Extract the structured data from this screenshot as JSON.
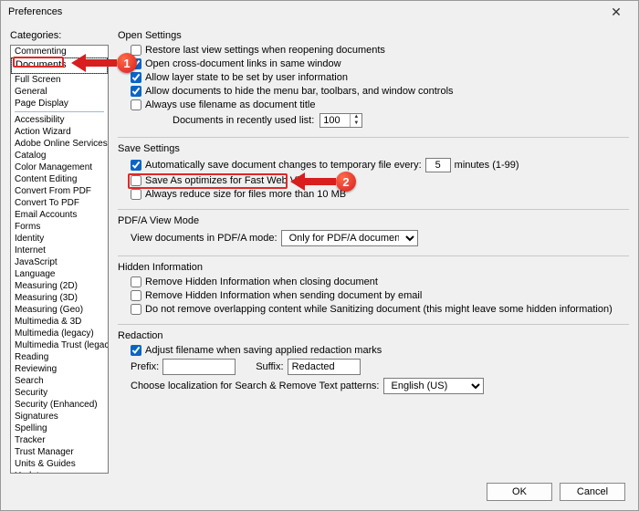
{
  "title": "Preferences",
  "categoriesLabel": "Categories:",
  "categories1": [
    "Commenting",
    "Documents",
    "Full Screen",
    "General",
    "Page Display"
  ],
  "categories2": [
    "Accessibility",
    "Action Wizard",
    "Adobe Online Services",
    "Catalog",
    "Color Management",
    "Content Editing",
    "Convert From PDF",
    "Convert To PDF",
    "Email Accounts",
    "Forms",
    "Identity",
    "Internet",
    "JavaScript",
    "Language",
    "Measuring (2D)",
    "Measuring (3D)",
    "Measuring (Geo)",
    "Multimedia & 3D",
    "Multimedia (legacy)",
    "Multimedia Trust (legacy)",
    "Reading",
    "Reviewing",
    "Search",
    "Security",
    "Security (Enhanced)",
    "Signatures",
    "Spelling",
    "Tracker",
    "Trust Manager",
    "Units & Guides",
    "Updater"
  ],
  "selectedCategoryIndex": 1,
  "open": {
    "title": "Open Settings",
    "restore": "Restore last view settings when reopening documents",
    "crossdoc": "Open cross-document links in same window",
    "layer": "Allow layer state to be set by user information",
    "hidemenu": "Allow documents to hide the menu bar, toolbars, and window controls",
    "filename": "Always use filename as document title",
    "recent_label": "Documents in recently used list:",
    "recent_value": "100"
  },
  "save": {
    "title": "Save Settings",
    "autosave": "Automatically save document changes to temporary file every:",
    "autosave_value": "5",
    "autosave_unit": "minutes (1-99)",
    "fastweb": "Save As optimizes for Fast Web View",
    "reduce": "Always reduce size for files more than 10 MB"
  },
  "pdfa": {
    "title": "PDF/A View Mode",
    "label": "View documents in PDF/A mode:",
    "value": "Only for PDF/A documents"
  },
  "hidden": {
    "title": "Hidden Information",
    "close": "Remove Hidden Information when closing document",
    "email": "Remove Hidden Information when sending document by email",
    "sanitize": "Do not remove overlapping content while Sanitizing document (this might leave some hidden information)"
  },
  "redact": {
    "title": "Redaction",
    "adjust": "Adjust filename when saving applied redaction marks",
    "prefix_lbl": "Prefix:",
    "prefix_val": "",
    "suffix_lbl": "Suffix:",
    "suffix_val": "Redacted",
    "locale_lbl": "Choose localization for Search & Remove Text patterns:",
    "locale_val": "English (US)"
  },
  "buttons": {
    "ok": "OK",
    "cancel": "Cancel"
  },
  "annotations": {
    "b1": "1",
    "b2": "2"
  }
}
